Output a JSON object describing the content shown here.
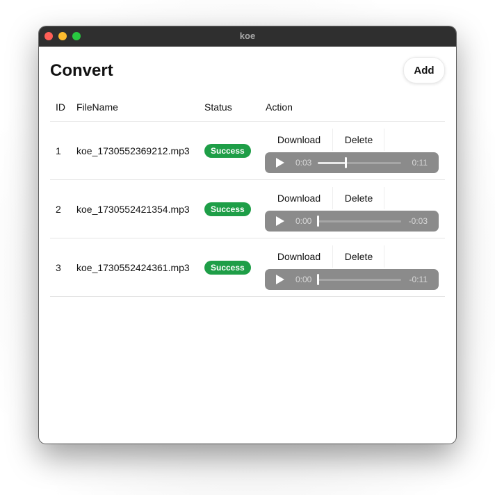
{
  "window": {
    "title": "koe"
  },
  "page": {
    "title": "Convert",
    "add_label": "Add"
  },
  "table": {
    "headers": {
      "id": "ID",
      "filename": "FileName",
      "status": "Status",
      "action": "Action"
    },
    "rows": [
      {
        "id": "1",
        "filename": "koe_1730552369212.mp3",
        "status": "Success",
        "download_label": "Download",
        "delete_label": "Delete",
        "player": {
          "current": "0:03",
          "remaining": "0:11",
          "progress": 0.33
        }
      },
      {
        "id": "2",
        "filename": "koe_1730552421354.mp3",
        "status": "Success",
        "download_label": "Download",
        "delete_label": "Delete",
        "player": {
          "current": "0:00",
          "remaining": "-0:03",
          "progress": 0.0
        }
      },
      {
        "id": "3",
        "filename": "koe_1730552424361.mp3",
        "status": "Success",
        "download_label": "Download",
        "delete_label": "Delete",
        "player": {
          "current": "0:00",
          "remaining": "-0:11",
          "progress": 0.0
        }
      }
    ]
  },
  "colors": {
    "status_success": "#1e9e47",
    "titlebar": "#2f2f2f",
    "player_bg": "#8b8b8b"
  },
  "icons": {
    "close": "traffic-close-icon",
    "minimize": "traffic-minimize-icon",
    "maximize": "traffic-maximize-icon",
    "play": "play-icon"
  }
}
